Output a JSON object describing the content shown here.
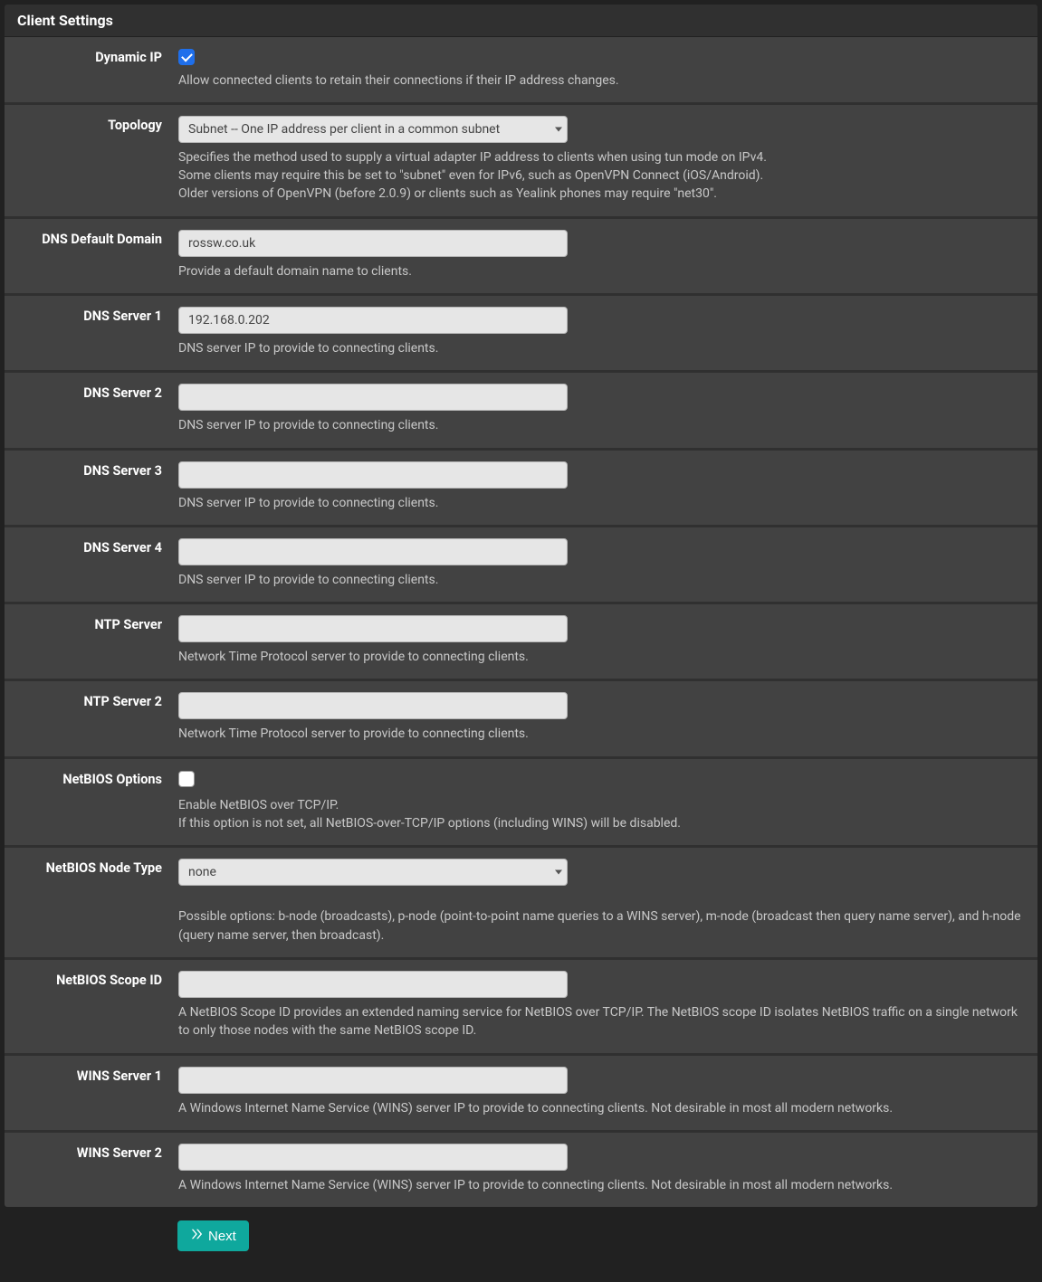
{
  "panel": {
    "title": "Client Settings"
  },
  "fields": {
    "dynamic_ip": {
      "label": "Dynamic IP",
      "checked": true,
      "help": "Allow connected clients to retain their connections if their IP address changes."
    },
    "topology": {
      "label": "Topology",
      "value": "Subnet -- One IP address per client in a common subnet",
      "help_line1": "Specifies the method used to supply a virtual adapter IP address to clients when using tun mode on IPv4.",
      "help_line2": "Some clients may require this be set to \"subnet\" even for IPv6, such as OpenVPN Connect (iOS/Android).",
      "help_line3": "Older versions of OpenVPN (before 2.0.9) or clients such as Yealink phones may require \"net30\"."
    },
    "dns_default_domain": {
      "label": "DNS Default Domain",
      "value": "rossw.co.uk",
      "help": "Provide a default domain name to clients."
    },
    "dns_server1": {
      "label": "DNS Server 1",
      "value": "192.168.0.202",
      "help": "DNS server IP to provide to connecting clients."
    },
    "dns_server2": {
      "label": "DNS Server 2",
      "value": "",
      "help": "DNS server IP to provide to connecting clients."
    },
    "dns_server3": {
      "label": "DNS Server 3",
      "value": "",
      "help": "DNS server IP to provide to connecting clients."
    },
    "dns_server4": {
      "label": "DNS Server 4",
      "value": "",
      "help": "DNS server IP to provide to connecting clients."
    },
    "ntp_server": {
      "label": "NTP Server",
      "value": "",
      "help": "Network Time Protocol server to provide to connecting clients."
    },
    "ntp_server2": {
      "label": "NTP Server 2",
      "value": "",
      "help": "Network Time Protocol server to provide to connecting clients."
    },
    "netbios_options": {
      "label": "NetBIOS Options",
      "checked": false,
      "help_line1": "Enable NetBIOS over TCP/IP.",
      "help_line2": "If this option is not set, all NetBIOS-over-TCP/IP options (including WINS) will be disabled."
    },
    "netbios_node_type": {
      "label": "NetBIOS Node Type",
      "value": "none",
      "help": "Possible options: b-node (broadcasts), p-node (point-to-point name queries to a WINS server), m-node (broadcast then query name server), and h-node (query name server, then broadcast)."
    },
    "netbios_scope_id": {
      "label": "NetBIOS Scope ID",
      "value": "",
      "help": "A NetBIOS Scope ID provides an extended naming service for NetBIOS over TCP/IP. The NetBIOS scope ID isolates NetBIOS traffic on a single network to only those nodes with the same NetBIOS scope ID."
    },
    "wins_server1": {
      "label": "WINS Server 1",
      "value": "",
      "help": "A Windows Internet Name Service (WINS) server IP to provide to connecting clients. Not desirable in most all modern networks."
    },
    "wins_server2": {
      "label": "WINS Server 2",
      "value": "",
      "help": "A Windows Internet Name Service (WINS) server IP to provide to connecting clients. Not desirable in most all modern networks."
    }
  },
  "footer": {
    "next_label": "Next"
  }
}
